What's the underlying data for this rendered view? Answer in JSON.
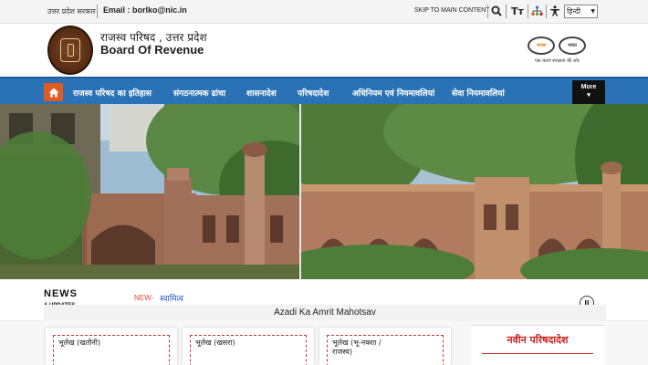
{
  "topbar": {
    "gov_label": "उत्तर प्रदेश सरकार",
    "email": "Email : borlko@nic.in",
    "skip_link": "SKIP TO MAIN CONTENT",
    "font_size_icon": "Tт",
    "language": "हिन्दी"
  },
  "header": {
    "title_hindi": "राजस्व परिषद , उत्तर प्रदेश",
    "title_english": "Board Of Revenue",
    "swachh_text_1": "स्वच्छ",
    "swachh_text_2": "भारत",
    "swachh_tagline": "एक कदम स्वच्छता की ओर"
  },
  "nav": {
    "items": [
      "राजस्व परिषद का इतिहास",
      "संगठनात्मक ढांचा",
      "शासनादेश",
      "परिषदादेश",
      "अधिनियम एवं नियमावलियां",
      "सेवा नियमावलियां"
    ],
    "more_label": "More",
    "more_chevron": "▾"
  },
  "news": {
    "label": "NEWS",
    "sub_label": "& UPDATES",
    "new_tag": "NEW-",
    "ticker_text": "स्वामित्व",
    "pause_icon": "II"
  },
  "azadi": {
    "text": "Azadi Ka Amrit Mahotsav"
  },
  "cards": [
    {
      "label": "भूलेख (खतौनी)"
    },
    {
      "label": "भूलेख (खसरा)"
    },
    {
      "label": "भूलेख (भू-नक्शा / राजस्व)"
    }
  ],
  "notice": {
    "title": "नवीन परिषदादेश"
  },
  "colors": {
    "nav_blue": "#2a72b5",
    "home_orange": "#e05a22",
    "notice_red": "#c62222",
    "ticker_blue": "#1a56c4"
  }
}
